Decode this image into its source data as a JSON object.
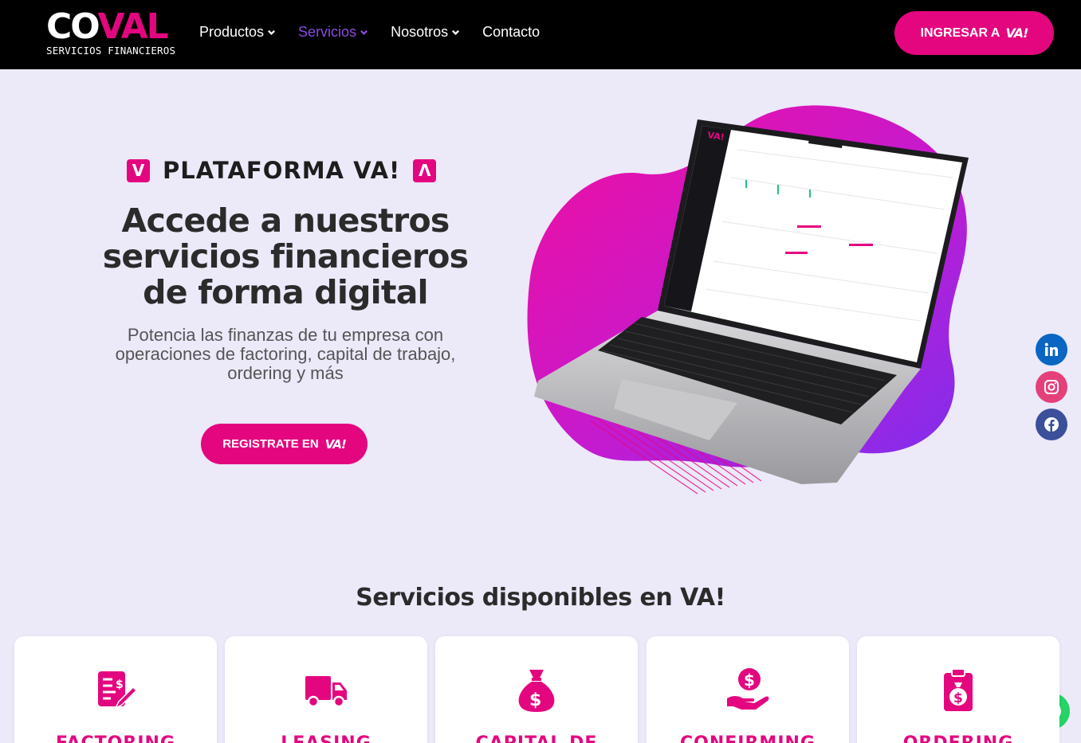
{
  "header": {
    "logo_text_1": "CO",
    "logo_text_2": "VAL",
    "logo_sub": "SERVICIOS FINANCIEROS",
    "nav": [
      {
        "label": "Productos"
      },
      {
        "label": "Servicios"
      },
      {
        "label": "Nosotros"
      },
      {
        "label": "Contacto"
      }
    ],
    "login_label": "INGRESAR A",
    "login_mark": "VA!"
  },
  "hero": {
    "kicker_left": "V",
    "kicker_text": "PLATAFORMA VA!",
    "kicker_right": "Λ",
    "title": "Accede a nuestros servicios financieros de forma digital",
    "subtitle": "Potencia las finanzas de tu empresa con operaciones de factoring, capital de trabajo, ordering y más",
    "register_label": "REGISTRATE EN",
    "register_mark": "VA!"
  },
  "services": {
    "title": "Servicios disponibles en VA!",
    "cards": [
      {
        "title": "FACTORING",
        "icon": "invoice-icon"
      },
      {
        "title": "LEASING",
        "icon": "truck-icon"
      },
      {
        "title": "CAPITAL DE",
        "icon": "money-bag-icon"
      },
      {
        "title": "CONFIRMING",
        "icon": "hand-coin-icon"
      },
      {
        "title": "ORDERING",
        "icon": "clipboard-money-icon"
      }
    ]
  },
  "colors": {
    "brand": "#e4067f",
    "purple": "#8a49e0",
    "header_bg": "#000000",
    "page_bg": "#ece9f9"
  },
  "social": [
    "linkedin-icon",
    "instagram-icon",
    "facebook-icon",
    "whatsapp-icon"
  ]
}
